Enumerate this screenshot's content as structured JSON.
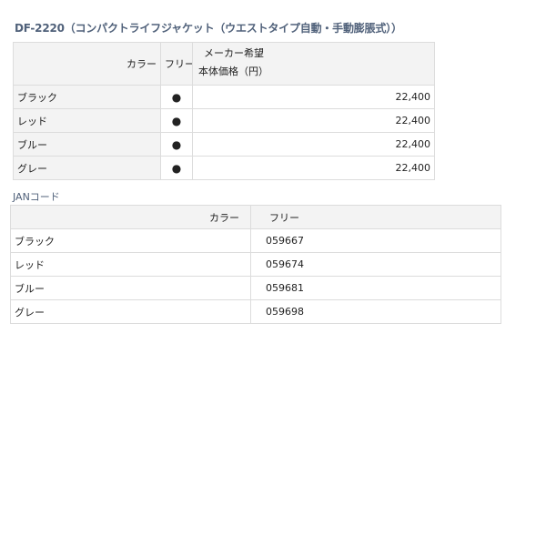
{
  "product": {
    "title": "DF-2220（コンパクトライフジャケット（ウエストタイプ自動・手動膨脹式））"
  },
  "price_table": {
    "headers": {
      "color": "カラー",
      "size": "フリー",
      "price_line1": "メーカー希望",
      "price_line2": "本体価格（円）"
    },
    "rows": [
      {
        "color": "ブラック",
        "mark": "●",
        "price": "22,400"
      },
      {
        "color": "レッド",
        "mark": "●",
        "price": "22,400"
      },
      {
        "color": "ブルー",
        "mark": "●",
        "price": "22,400"
      },
      {
        "color": "グレー",
        "mark": "●",
        "price": "22,400"
      }
    ]
  },
  "jan": {
    "heading": "JANコード",
    "headers": {
      "color": "カラー",
      "size": "フリー"
    },
    "rows": [
      {
        "color": "ブラック",
        "code": "059667"
      },
      {
        "color": "レッド",
        "code": "059674"
      },
      {
        "color": "ブルー",
        "code": "059681"
      },
      {
        "color": "グレー",
        "code": "059698"
      }
    ]
  }
}
